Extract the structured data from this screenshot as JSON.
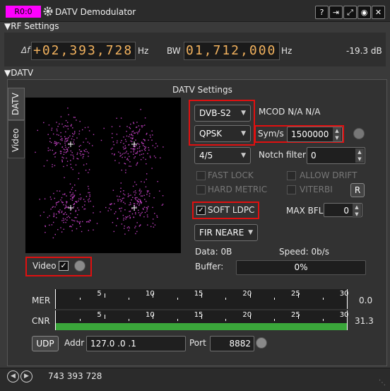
{
  "window": {
    "device_badge": "R0:0",
    "title": "DATV Demodulator"
  },
  "rf_settings": {
    "header": "RF Settings",
    "delta_label": "Δf",
    "delta_value": "+02,393,728",
    "delta_unit": "Hz",
    "bw_label": "BW",
    "bw_value": "01,712,000",
    "bw_unit": "Hz",
    "power": "-19.3 dB"
  },
  "datv": {
    "header": "DATV",
    "tabs": [
      "DATV",
      "Video"
    ],
    "settings_title": "DATV Settings",
    "standard": "DVB-S2",
    "modulation": "QPSK",
    "fec": "4/5",
    "mcod_label": "MCOD N/A N/A",
    "symrate_label": "Sym/s",
    "symrate_value": "1500000",
    "notch_label": "Notch filter",
    "notch_value": "0",
    "fast_lock": "FAST LOCK",
    "allow_drift": "ALLOW DRIFT",
    "hard_metric": "HARD METRIC",
    "viterbi": "VITERBI",
    "reset_label": "R",
    "soft_ldpc": "SOFT LDPC",
    "soft_ldpc_checked": true,
    "max_bfl_label": "MAX BFL",
    "max_bfl_value": "0",
    "filter": "FIR NEARE",
    "data_text": "Data: 0B",
    "speed_text": "Speed: 0b/s",
    "buffer_label": "Buffer:",
    "buffer_value": "0%",
    "buffer_fraction": 0,
    "video_label": "Video",
    "video_checked": true
  },
  "meters": {
    "mer_label": "MER",
    "mer_value": "0.0",
    "mer_fraction": 0,
    "cnr_label": "CNR",
    "cnr_value": "31.3",
    "cnr_fraction": 1,
    "ticks": [
      "5",
      "10",
      "15",
      "20",
      "25",
      "30"
    ]
  },
  "udp": {
    "button": "UDP",
    "addr_label": "Addr",
    "addr_value": "127.0 .0 .1",
    "port_label": "Port",
    "port_value": "8882"
  },
  "status": {
    "frequency": "743 393 728"
  },
  "colors": {
    "badge": "#ff00ff",
    "lcd_text": "#f2b25e",
    "highlight": "#e01010",
    "cnr_bar": "#3aa63a",
    "constellation": "#c040c0"
  }
}
